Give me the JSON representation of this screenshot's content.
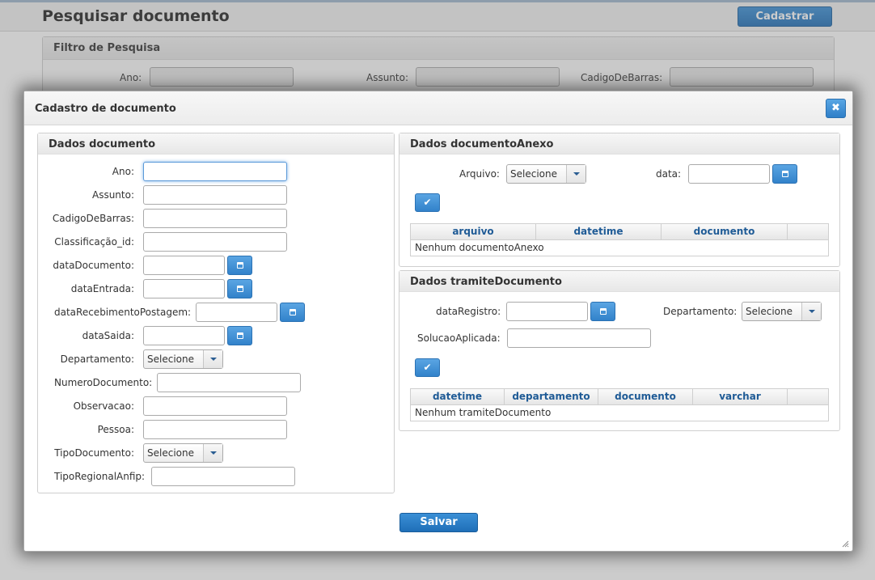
{
  "page": {
    "title": "Pesquisar documento",
    "cadastrar_label": "Cadastrar"
  },
  "filter": {
    "title": "Filtro de Pesquisa",
    "ano_label": "Ano:",
    "assunto_label": "Assunto:",
    "codigo_label": "CadigoDeBarras:"
  },
  "dialog": {
    "title": "Cadastro de documento",
    "close_icon": "close-icon",
    "save_label": "Salvar",
    "documento": {
      "title": "Dados documento",
      "ano": "Ano:",
      "assunto": "Assunto:",
      "codigo": "CadigoDeBarras:",
      "classificacao": "Classificação_id:",
      "data_documento": "dataDocumento:",
      "data_entrada": "dataEntrada:",
      "data_recebimento": "dataRecebimentoPostagem:",
      "data_saida": "dataSaida:",
      "departamento": "Departamento:",
      "departamento_value": "Selecione",
      "numero": "NumeroDocumento:",
      "observacao": "Observacao:",
      "pessoa": "Pessoa:",
      "tipo_documento": "TipoDocumento:",
      "tipo_documento_value": "Selecione",
      "tipo_regional": "TipoRegionalAnfip:"
    },
    "anexo": {
      "title": "Dados documentoAnexo",
      "arquivo_label": "Arquivo:",
      "arquivo_value": "Selecione",
      "data_label": "data:",
      "columns": [
        "arquivo",
        "datetime",
        "documento"
      ],
      "empty": "Nenhum documentoAnexo"
    },
    "tramite": {
      "title": "Dados tramiteDocumento",
      "data_registro_label": "dataRegistro:",
      "departamento_label": "Departamento:",
      "departamento_value": "Selecione",
      "solucao_label": "SolucaoAplicada:",
      "columns": [
        "datetime",
        "departamento",
        "documento",
        "varchar"
      ],
      "empty": "Nenhum tramiteDocumento"
    }
  },
  "colors": {
    "accent": "#2f7fc8",
    "header_text": "#1f5b96"
  }
}
